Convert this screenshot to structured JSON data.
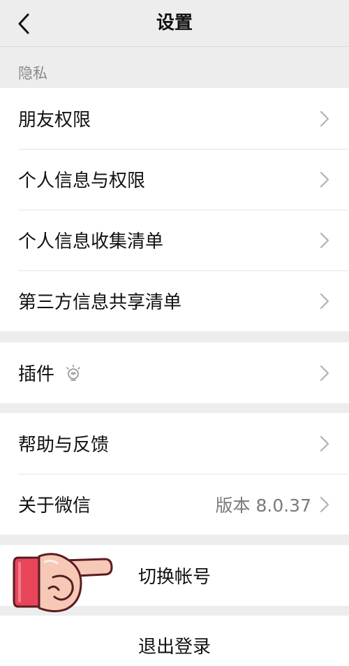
{
  "header": {
    "title": "设置",
    "back_icon": "chevron-left-icon"
  },
  "privacy": {
    "caption": "隐私",
    "items": [
      {
        "label": "朋友权限"
      },
      {
        "label": "个人信息与权限"
      },
      {
        "label": "个人信息收集清单"
      },
      {
        "label": "第三方信息共享清单"
      }
    ]
  },
  "plugins": {
    "label": "插件",
    "icon": "lightbulb-icon"
  },
  "support": {
    "items": [
      {
        "label": "帮助与反馈"
      },
      {
        "label": "关于微信",
        "value": "版本 8.0.37"
      }
    ]
  },
  "account": {
    "switch_label": "切换帐号",
    "logout_label": "退出登录"
  },
  "colors": {
    "background": "#ededed",
    "card": "#ffffff",
    "text": "#111111",
    "secondary_text": "#7a7a7a",
    "caption_text": "#8a8a8a",
    "finger_sleeve": "#e8455a",
    "finger_skin": "#f6c8b6"
  },
  "overlay": {
    "icon": "pointing-finger-emoji-icon"
  }
}
